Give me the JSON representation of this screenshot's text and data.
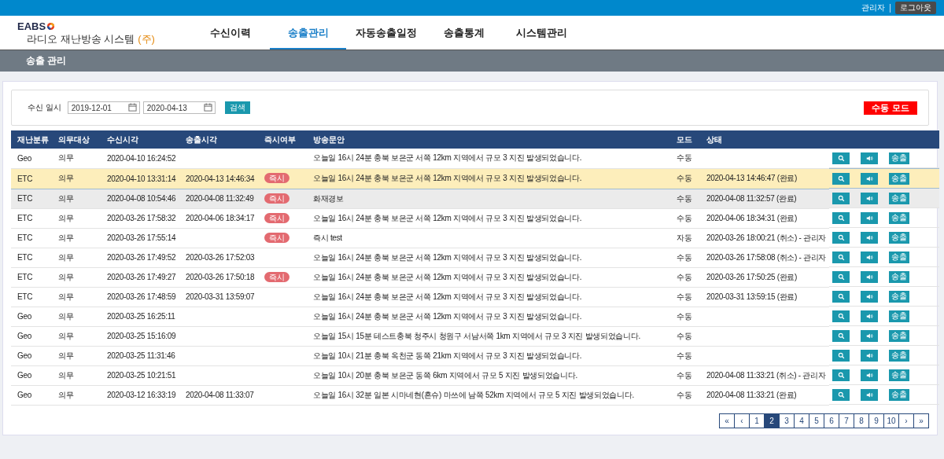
{
  "top_bar": {
    "user": "관리자",
    "logout_button": "로그아웃"
  },
  "header": {
    "logo_text": "EABS",
    "system_name": "라디오 재난방송 시스템",
    "company_mark": "(주)"
  },
  "nav_tabs": [
    {
      "label": "수신이력",
      "selected": false
    },
    {
      "label": "송출관리",
      "selected": true
    },
    {
      "label": "자동송출일정",
      "selected": false
    },
    {
      "label": "송출통계",
      "selected": false
    },
    {
      "label": "시스템관리",
      "selected": false
    }
  ],
  "page_title": "송출 관리",
  "filter": {
    "label": "수신 일시",
    "start_date": "2019-12-01",
    "end_date": "2020-04-13",
    "search_button": "검색",
    "mode_badge": "수동 모드"
  },
  "table": {
    "columns": [
      "재난분류",
      "의무대상",
      "수신시각",
      "송출시각",
      "즉시여부",
      "방송문안",
      "모드",
      "상태"
    ],
    "rows": [
      {
        "category": "Geo",
        "obligation": "의무",
        "received": "2020-04-10 16:24:52",
        "sent": "",
        "immediate": "",
        "message": "오늘일 16시 24분 충북 보은군 서쪽 12km 지역에서 규모 3 지진 발생되었습니다.",
        "mode": "수동",
        "status": "",
        "send_button": "송출",
        "selected": false,
        "hovered": false
      },
      {
        "category": "ETC",
        "obligation": "의무",
        "received": "2020-04-10 13:31:14",
        "sent": "2020-04-13 14:46:34",
        "immediate": "즉시",
        "message": "오늘일 16시 24분 충북 보은군 서쪽 12km 지역에서 규모 3 지진 발생되었습니다.",
        "mode": "수동",
        "status": "2020-04-13 14:46:47 (완료)",
        "send_button": "송출",
        "selected": true,
        "hovered": false
      },
      {
        "category": "ETC",
        "obligation": "의무",
        "received": "2020-04-08 10:54:46",
        "sent": "2020-04-08 11:32:49",
        "immediate": "즉시",
        "message": "화재경보",
        "mode": "수동",
        "status": "2020-04-08 11:32:57 (완료)",
        "send_button": "송출",
        "selected": false,
        "hovered": true
      },
      {
        "category": "ETC",
        "obligation": "의무",
        "received": "2020-03-26 17:58:32",
        "sent": "2020-04-06 18:34:17",
        "immediate": "즉시",
        "message": "오늘일 16시 24분 충북 보은군 서쪽 12km 지역에서 규모 3 지진 발생되었습니다.",
        "mode": "수동",
        "status": "2020-04-06 18:34:31 (완료)",
        "send_button": "송출",
        "selected": false,
        "hovered": false
      },
      {
        "category": "ETC",
        "obligation": "의무",
        "received": "2020-03-26 17:55:14",
        "sent": "",
        "immediate": "즉시",
        "message": "즉시 test",
        "mode": "자동",
        "status": "2020-03-26 18:00:21 (취소) - 관리자",
        "send_button": "송출",
        "selected": false,
        "hovered": false
      },
      {
        "category": "ETC",
        "obligation": "의무",
        "received": "2020-03-26 17:49:52",
        "sent": "2020-03-26 17:52:03",
        "immediate": "",
        "message": "오늘일 16시 24분 충북 보은군 서쪽 12km 지역에서 규모 3 지진 발생되었습니다.",
        "mode": "수동",
        "status": "2020-03-26 17:58:08 (취소) - 관리자",
        "send_button": "송출",
        "selected": false,
        "hovered": false
      },
      {
        "category": "ETC",
        "obligation": "의무",
        "received": "2020-03-26 17:49:27",
        "sent": "2020-03-26 17:50:18",
        "immediate": "즉시",
        "message": "오늘일 16시 24분 충북 보은군 서쪽 12km 지역에서 규모 3 지진 발생되었습니다.",
        "mode": "수동",
        "status": "2020-03-26 17:50:25 (완료)",
        "send_button": "송출",
        "selected": false,
        "hovered": false
      },
      {
        "category": "ETC",
        "obligation": "의무",
        "received": "2020-03-26 17:48:59",
        "sent": "2020-03-31 13:59:07",
        "immediate": "",
        "message": "오늘일 16시 24분 충북 보은군 서쪽 12km 지역에서 규모 3 지진 발생되었습니다.",
        "mode": "수동",
        "status": "2020-03-31 13:59:15 (완료)",
        "send_button": "송출",
        "selected": false,
        "hovered": false
      },
      {
        "category": "Geo",
        "obligation": "의무",
        "received": "2020-03-25 16:25:11",
        "sent": "",
        "immediate": "",
        "message": "오늘일 16시 24분 충북 보은군 서쪽 12km 지역에서 규모 3 지진 발생되었습니다.",
        "mode": "수동",
        "status": "",
        "send_button": "송출",
        "selected": false,
        "hovered": false
      },
      {
        "category": "Geo",
        "obligation": "의무",
        "received": "2020-03-25 15:16:09",
        "sent": "",
        "immediate": "",
        "message": "오늘일 15시 15분 테스트충북 청주시 청원구 서남서쪽 1km 지역에서 규모 3 지진 발생되었습니다.",
        "mode": "수동",
        "status": "",
        "send_button": "송출",
        "selected": false,
        "hovered": false
      },
      {
        "category": "Geo",
        "obligation": "의무",
        "received": "2020-03-25 11:31:46",
        "sent": "",
        "immediate": "",
        "message": "오늘일 10시 21분 충북 옥천군 동쪽 21km 지역에서 규모 3 지진 발생되었습니다.",
        "mode": "수동",
        "status": "",
        "send_button": "송출",
        "selected": false,
        "hovered": false
      },
      {
        "category": "Geo",
        "obligation": "의무",
        "received": "2020-03-25 10:21:51",
        "sent": "",
        "immediate": "",
        "message": "오늘일 10시 20분 충북 보은군 동쪽 6km 지역에서 규모 5 지진 발생되었습니다.",
        "mode": "수동",
        "status": "2020-04-08 11:33:21 (취소) - 관리자",
        "send_button": "송출",
        "selected": false,
        "hovered": false
      },
      {
        "category": "Geo",
        "obligation": "의무",
        "received": "2020-03-12 16:33:19",
        "sent": "2020-04-08 11:33:07",
        "immediate": "",
        "message": "오늘일 16시 32분 일본 시마네현(혼슈) 마쓰에 남쪽 52km 지역에서 규모 5 지진 발생되었습니다.",
        "mode": "수동",
        "status": "2020-04-08 11:33:21 (완료)",
        "send_button": "송출",
        "selected": false,
        "hovered": false
      }
    ]
  },
  "pagination": [
    {
      "label": "«",
      "selected": false
    },
    {
      "label": "‹",
      "selected": false
    },
    {
      "label": "1",
      "selected": false
    },
    {
      "label": "2",
      "selected": true
    },
    {
      "label": "3",
      "selected": false
    },
    {
      "label": "4",
      "selected": false
    },
    {
      "label": "5",
      "selected": false
    },
    {
      "label": "6",
      "selected": false
    },
    {
      "label": "7",
      "selected": false
    },
    {
      "label": "8",
      "selected": false
    },
    {
      "label": "9",
      "selected": false
    },
    {
      "label": "10",
      "selected": false
    },
    {
      "label": "›",
      "selected": false
    },
    {
      "label": "»",
      "selected": false
    }
  ]
}
